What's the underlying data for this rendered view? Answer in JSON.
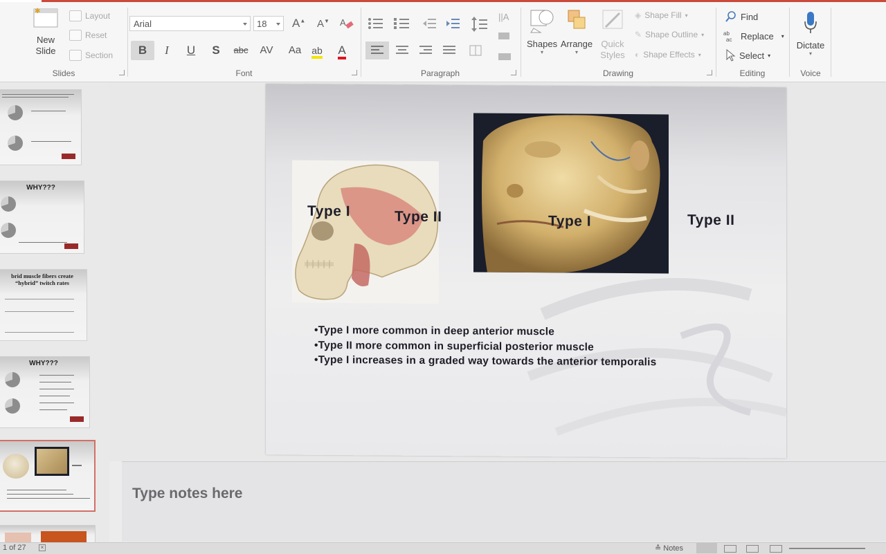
{
  "ribbon": {
    "slides_group": {
      "label": "Slides",
      "new_slide": "New\nSlide",
      "layout": "Layout",
      "reset": "Reset",
      "section": "Section"
    },
    "font_group": {
      "label": "Font",
      "font_name": "Arial",
      "font_size": "18",
      "bold": "B",
      "italic": "I",
      "underline": "U",
      "shadow": "S",
      "strikethrough": "abc",
      "char_spacing": "AV",
      "change_case": "Aa",
      "grow": "A",
      "shrink": "A",
      "highlight": "ab",
      "font_color": "A"
    },
    "paragraph_group": {
      "label": "Paragraph"
    },
    "drawing_group": {
      "label": "Drawing",
      "shapes": "Shapes",
      "arrange": "Arrange",
      "quick_styles": "Quick\nStyles",
      "shape_fill": "Shape Fill",
      "shape_outline": "Shape Outline",
      "shape_effects": "Shape Effects"
    },
    "editing_group": {
      "label": "Editing",
      "find": "Find",
      "replace": "Replace",
      "select": "Select"
    },
    "voice_group": {
      "label": "Voice",
      "dictate": "Dictate"
    }
  },
  "thumbnails": [
    {
      "title": ""
    },
    {
      "title": "WHY???"
    },
    {
      "title": "brid muscle fibers create “hybrid” twitch rates"
    },
    {
      "title": "WHY???"
    },
    {
      "title": "",
      "selected": true
    },
    {
      "title": ""
    }
  ],
  "slide": {
    "labels": {
      "skull_type1": "Type I",
      "skull_type2": "Type II",
      "face_type1": "Type I",
      "right_type2": "Type II"
    },
    "bullets": [
      "•Type I more common in deep anterior muscle",
      "•Type II more common in superficial posterior muscle",
      "•Type I increases in a graded way towards the anterior temporalis"
    ]
  },
  "notes": {
    "placeholder": "Type notes here"
  },
  "status": {
    "slide_counter": "1 of 27",
    "notes_button": "Notes"
  },
  "colors": {
    "accent": "#c94a3a",
    "selected_thumb_border": "#d26f66"
  }
}
